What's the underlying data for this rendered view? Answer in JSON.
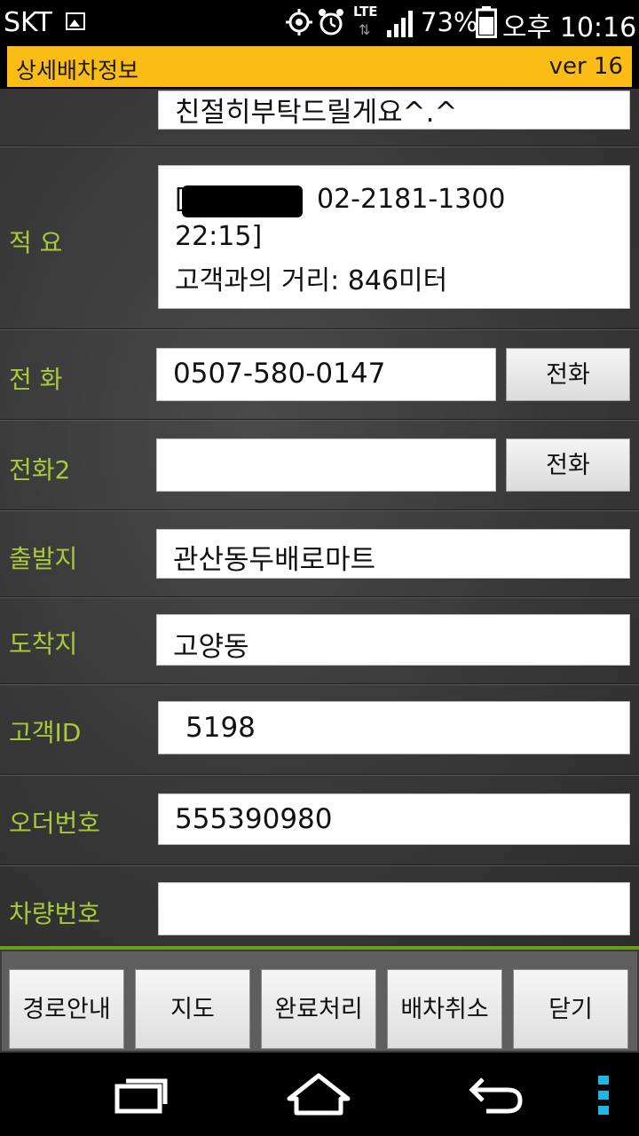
{
  "status_bar": {
    "carrier": "SKT",
    "network": "LTE",
    "battery": "73%",
    "time": "오후 10:16"
  },
  "header": {
    "title": "상세배차정보",
    "version": "ver 16"
  },
  "rows": {
    "memo": {
      "value": "친절히부탁드릴게요^.^"
    },
    "summary": {
      "label": "적 요",
      "line1_phone": "02-2181-1300",
      "line2": "22:15]",
      "line3": "고객과의 거리: 846미터"
    },
    "phone": {
      "label": "전 화",
      "value": "0507-580-0147",
      "button": "전화"
    },
    "phone2": {
      "label": "전화2",
      "value": "",
      "button": "전화"
    },
    "origin": {
      "label": "출발지",
      "value": "관산동두배로마트"
    },
    "destination": {
      "label": "도착지",
      "value": "고양동"
    },
    "customer_id": {
      "label": "고객ID",
      "value": "5198"
    },
    "order_no": {
      "label": "오더번호",
      "value": "555390980"
    },
    "vehicle_no": {
      "label": "차량번호",
      "value": ""
    }
  },
  "toolbar": {
    "route": "경로안내",
    "map": "지도",
    "complete": "완료처리",
    "cancel": "배차취소",
    "close": "닫기"
  },
  "icons": {
    "status": [
      "image-notification-icon",
      "gps-icon",
      "alarm-icon",
      "signal-icon",
      "battery-icon"
    ],
    "nav": [
      "recent-apps-icon",
      "home-icon",
      "back-icon",
      "menu-icon"
    ]
  },
  "colors": {
    "header_bg": "#fbbd15",
    "label_text": "#a9c938",
    "toolbar_accent": "#6b9e10",
    "menu_dots": "#1fb6e6"
  }
}
